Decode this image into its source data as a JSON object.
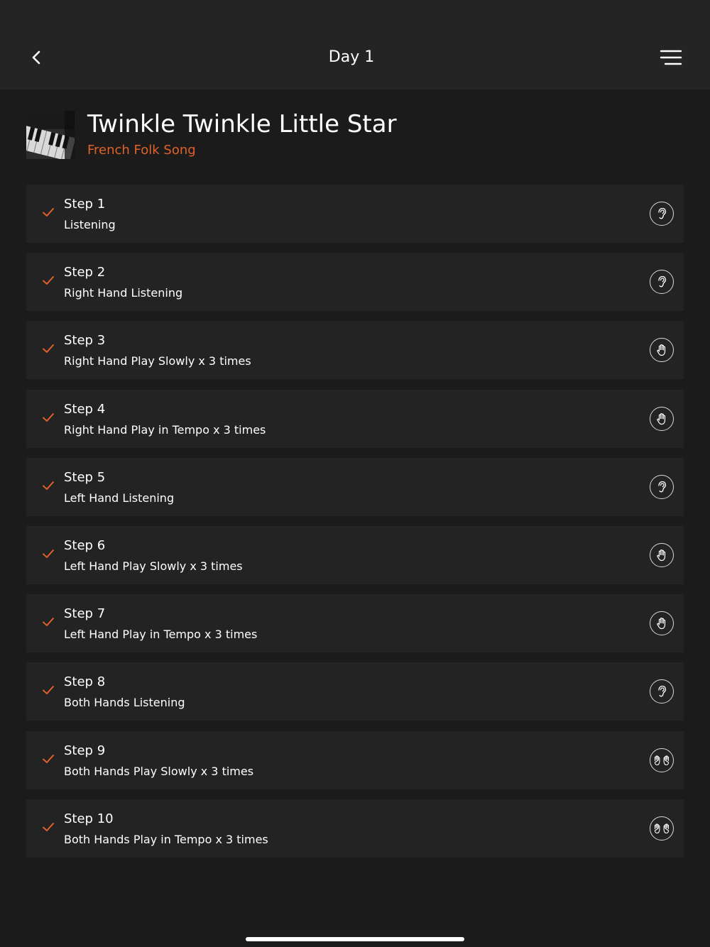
{
  "nav": {
    "back_icon": "chevron-left-icon",
    "title": "Day 1",
    "menu_icon": "hamburger-menu-icon"
  },
  "song": {
    "thumbnail": "piano-keys-image",
    "title": "Twinkle Twinkle Little Star",
    "artist": "French Folk Song"
  },
  "colors": {
    "accent": "#e0622a",
    "background": "#1b1b1b",
    "card": "#232323",
    "nav": "#242424"
  },
  "steps": [
    {
      "name": "Step 1",
      "description": "Listening",
      "completed": true,
      "icon": "ear-icon"
    },
    {
      "name": "Step 2",
      "description": "Right Hand Listening",
      "completed": true,
      "icon": "ear-icon"
    },
    {
      "name": "Step 3",
      "description": "Right Hand Play Slowly x 3 times",
      "completed": true,
      "icon": "hand-icon"
    },
    {
      "name": "Step 4",
      "description": "Right Hand Play in Tempo x 3 times",
      "completed": true,
      "icon": "hand-icon"
    },
    {
      "name": "Step 5",
      "description": "Left Hand Listening",
      "completed": true,
      "icon": "ear-icon"
    },
    {
      "name": "Step 6",
      "description": "Left Hand Play Slowly x 3 times",
      "completed": true,
      "icon": "hand-icon"
    },
    {
      "name": "Step 7",
      "description": "Left Hand Play in Tempo x 3 times",
      "completed": true,
      "icon": "hand-icon"
    },
    {
      "name": "Step 8",
      "description": "Both Hands Listening",
      "completed": true,
      "icon": "ear-icon"
    },
    {
      "name": "Step 9",
      "description": "Both Hands Play Slowly x 3 times",
      "completed": true,
      "icon": "both-hands-icon"
    },
    {
      "name": "Step 10",
      "description": "Both Hands Play in Tempo x 3 times",
      "completed": true,
      "icon": "both-hands-icon"
    }
  ]
}
